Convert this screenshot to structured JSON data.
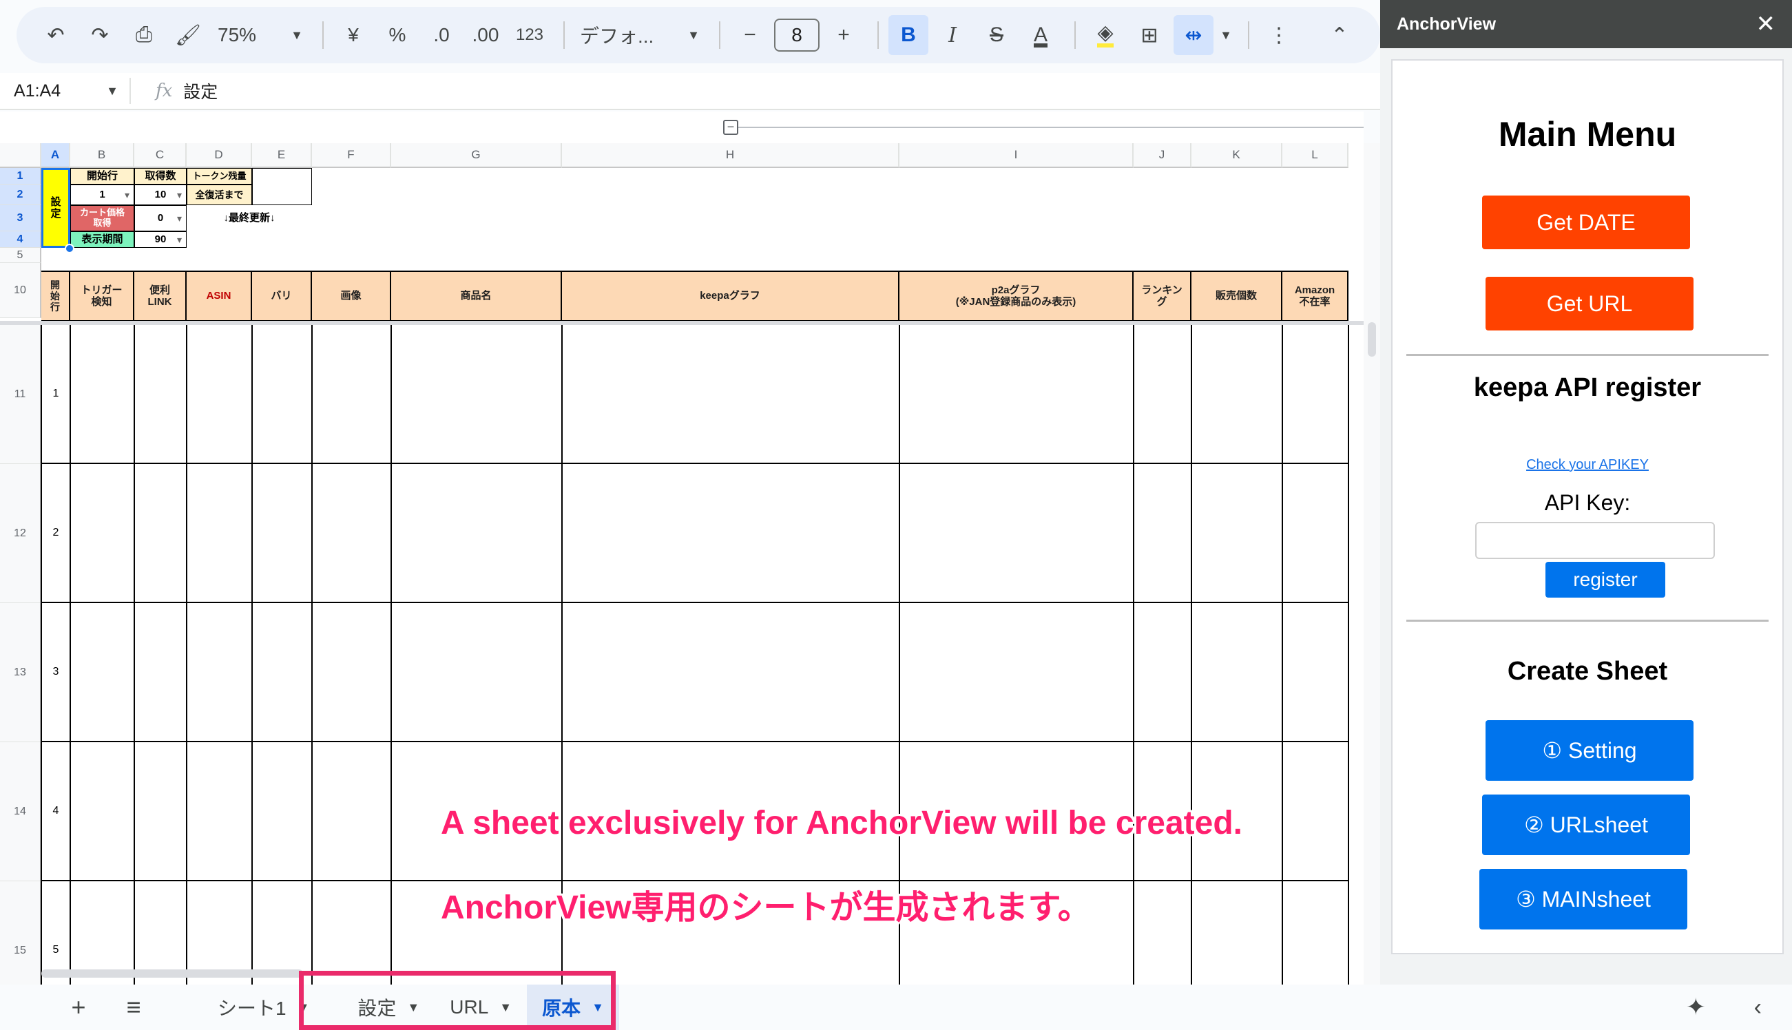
{
  "toolbar": {
    "zoom": "75%",
    "currency": "¥",
    "percent": "%",
    "dec_less": ".0",
    "dec_more": ".00",
    "number_format": "123",
    "font": "デフォ...",
    "font_size": "8"
  },
  "formula_bar": {
    "range": "A1:A4",
    "fx": "fx",
    "value": "設定"
  },
  "columns": [
    "A",
    "B",
    "C",
    "D",
    "E",
    "F",
    "G",
    "H",
    "I",
    "J",
    "K",
    "L"
  ],
  "rows_top": [
    "1",
    "2",
    "3",
    "4",
    "5",
    "10"
  ],
  "rows_data": [
    "11",
    "12",
    "13",
    "14",
    "15"
  ],
  "settings_block": {
    "a_label": "設\n定",
    "b1": "開始行",
    "c1": "取得数",
    "d1": "トークン残量",
    "b2": "1",
    "c2": "10",
    "d2": "全復活まで",
    "b3": "カート価格\n取得",
    "c3": "0",
    "d3": "↓最終更新↓",
    "b4": "表示期間",
    "c4": "90"
  },
  "header_cells": {
    "a": "開\n始\n行",
    "b": "トリガー\n検知",
    "c": "便利\nLINK",
    "d": "ASIN",
    "e": "バリ",
    "f": "画像",
    "g": "商品名",
    "h": "keepaグラフ",
    "i": "p2aグラフ\n(※JAN登録商品のみ表示)",
    "j": "ランキン\nグ",
    "k": "販売個数",
    "l": "Amazon\n不在率"
  },
  "row_numbers": [
    "1",
    "2",
    "3",
    "4",
    "5"
  ],
  "overlay": {
    "en": "A sheet exclusively for AnchorView will be created.",
    "jp": "AnchorView専用のシートが生成されます。"
  },
  "tabs": [
    {
      "label": "シート1"
    },
    {
      "label": "設定"
    },
    {
      "label": "URL"
    },
    {
      "label": "原本"
    }
  ],
  "panel": {
    "title": "AnchorView",
    "main_menu": "Main Menu",
    "get_date": "Get DATE",
    "get_url": "Get URL",
    "keepa_title": "keepa API register",
    "check_link": "Check your APIKEY",
    "api_key_label": "API Key:",
    "api_key_value": "",
    "register": "register",
    "create_sheet": "Create Sheet",
    "setting": "① Setting",
    "urlsheet": "② URLsheet",
    "mainsheet": "③ MAINsheet"
  },
  "colors": {
    "accent_orange": "#ff4200",
    "accent_blue": "#0074ed",
    "highlight_pink": "#ea2a6a",
    "overlay_text": "#ff1f6e"
  }
}
